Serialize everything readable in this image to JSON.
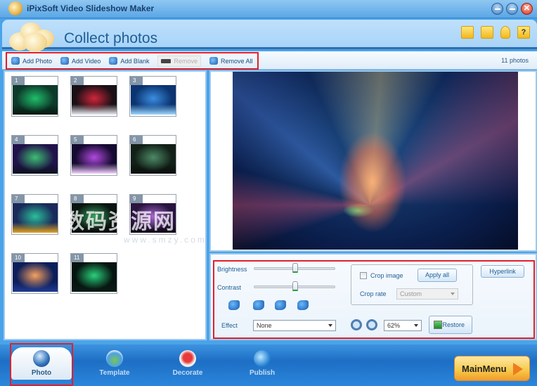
{
  "window": {
    "title": "iPixSoft Video Slideshow Maker",
    "buttons": [
      "minimize",
      "maximize",
      "close"
    ]
  },
  "header": {
    "page_title": "Collect photos",
    "icons": [
      "open-folder-icon",
      "save-icon",
      "user-icon",
      "help-icon"
    ],
    "help_glyph": "?"
  },
  "toolbar": {
    "buttons": [
      {
        "label": "Add Photo",
        "enabled": true
      },
      {
        "label": "Add Video",
        "enabled": true
      },
      {
        "label": "Add Blank",
        "enabled": true
      },
      {
        "label": "Remove",
        "enabled": false
      },
      {
        "label": "Remove All",
        "enabled": true
      }
    ],
    "photo_count": "11 photos"
  },
  "photos": [
    {
      "number": "1",
      "colors": [
        "#0d3a2a",
        "#1fbf6a",
        "#061a12"
      ]
    },
    {
      "number": "2",
      "colors": [
        "#1a1015",
        "#d0263a",
        "#e8eaf0"
      ]
    },
    {
      "number": "3",
      "colors": [
        "#0b3470",
        "#3b8de0",
        "#9cd8ff"
      ]
    },
    {
      "number": "4",
      "colors": [
        "#21124a",
        "#3dbf72",
        "#0c1220"
      ]
    },
    {
      "number": "5",
      "colors": [
        "#150a30",
        "#b24ae0",
        "#f4d2ff"
      ]
    },
    {
      "number": "6",
      "colors": [
        "#122018",
        "#4d8a66",
        "#0b0f0c"
      ]
    },
    {
      "number": "7",
      "colors": [
        "#1a2a5a",
        "#2bbf9a",
        "#e0a220"
      ]
    },
    {
      "number": "8",
      "colors": [
        "#0a1410",
        "#3aa060",
        "#08100c"
      ]
    },
    {
      "number": "9",
      "colors": [
        "#2a1440",
        "#a86ad0",
        "#100818"
      ]
    },
    {
      "number": "10",
      "colors": [
        "#0c1e5a",
        "#f6a060",
        "#203a90"
      ]
    },
    {
      "number": "11",
      "colors": [
        "#061410",
        "#2ad07a",
        "#0a1a14"
      ]
    }
  ],
  "controls": {
    "brightness_label": "Brightness",
    "brightness_value": 0.5,
    "contrast_label": "Contrast",
    "contrast_value": 0.5,
    "rotate_icons": [
      "rotate-left-icon",
      "rotate-right-icon",
      "flip-horizontal-icon",
      "flip-vertical-icon"
    ],
    "effect_label": "Effect",
    "effect_value": "None",
    "crop_image_label": "Crop image",
    "crop_image_checked": false,
    "apply_all_label": "Apply all",
    "crop_rate_label": "Crop rate",
    "crop_rate_value": "Custom",
    "hyperlink_label": "Hyperlink",
    "zoom_value": "62%",
    "restore_label": "Restore"
  },
  "bottom_nav": {
    "tabs": [
      {
        "label": "Photo",
        "active": true
      },
      {
        "label": "Template",
        "active": false
      },
      {
        "label": "Decorate",
        "active": false
      },
      {
        "label": "Publish",
        "active": false
      }
    ],
    "main_menu_label": "MainMenu"
  },
  "watermark": {
    "text": "数码资源网",
    "url": "www.smzy.com"
  }
}
